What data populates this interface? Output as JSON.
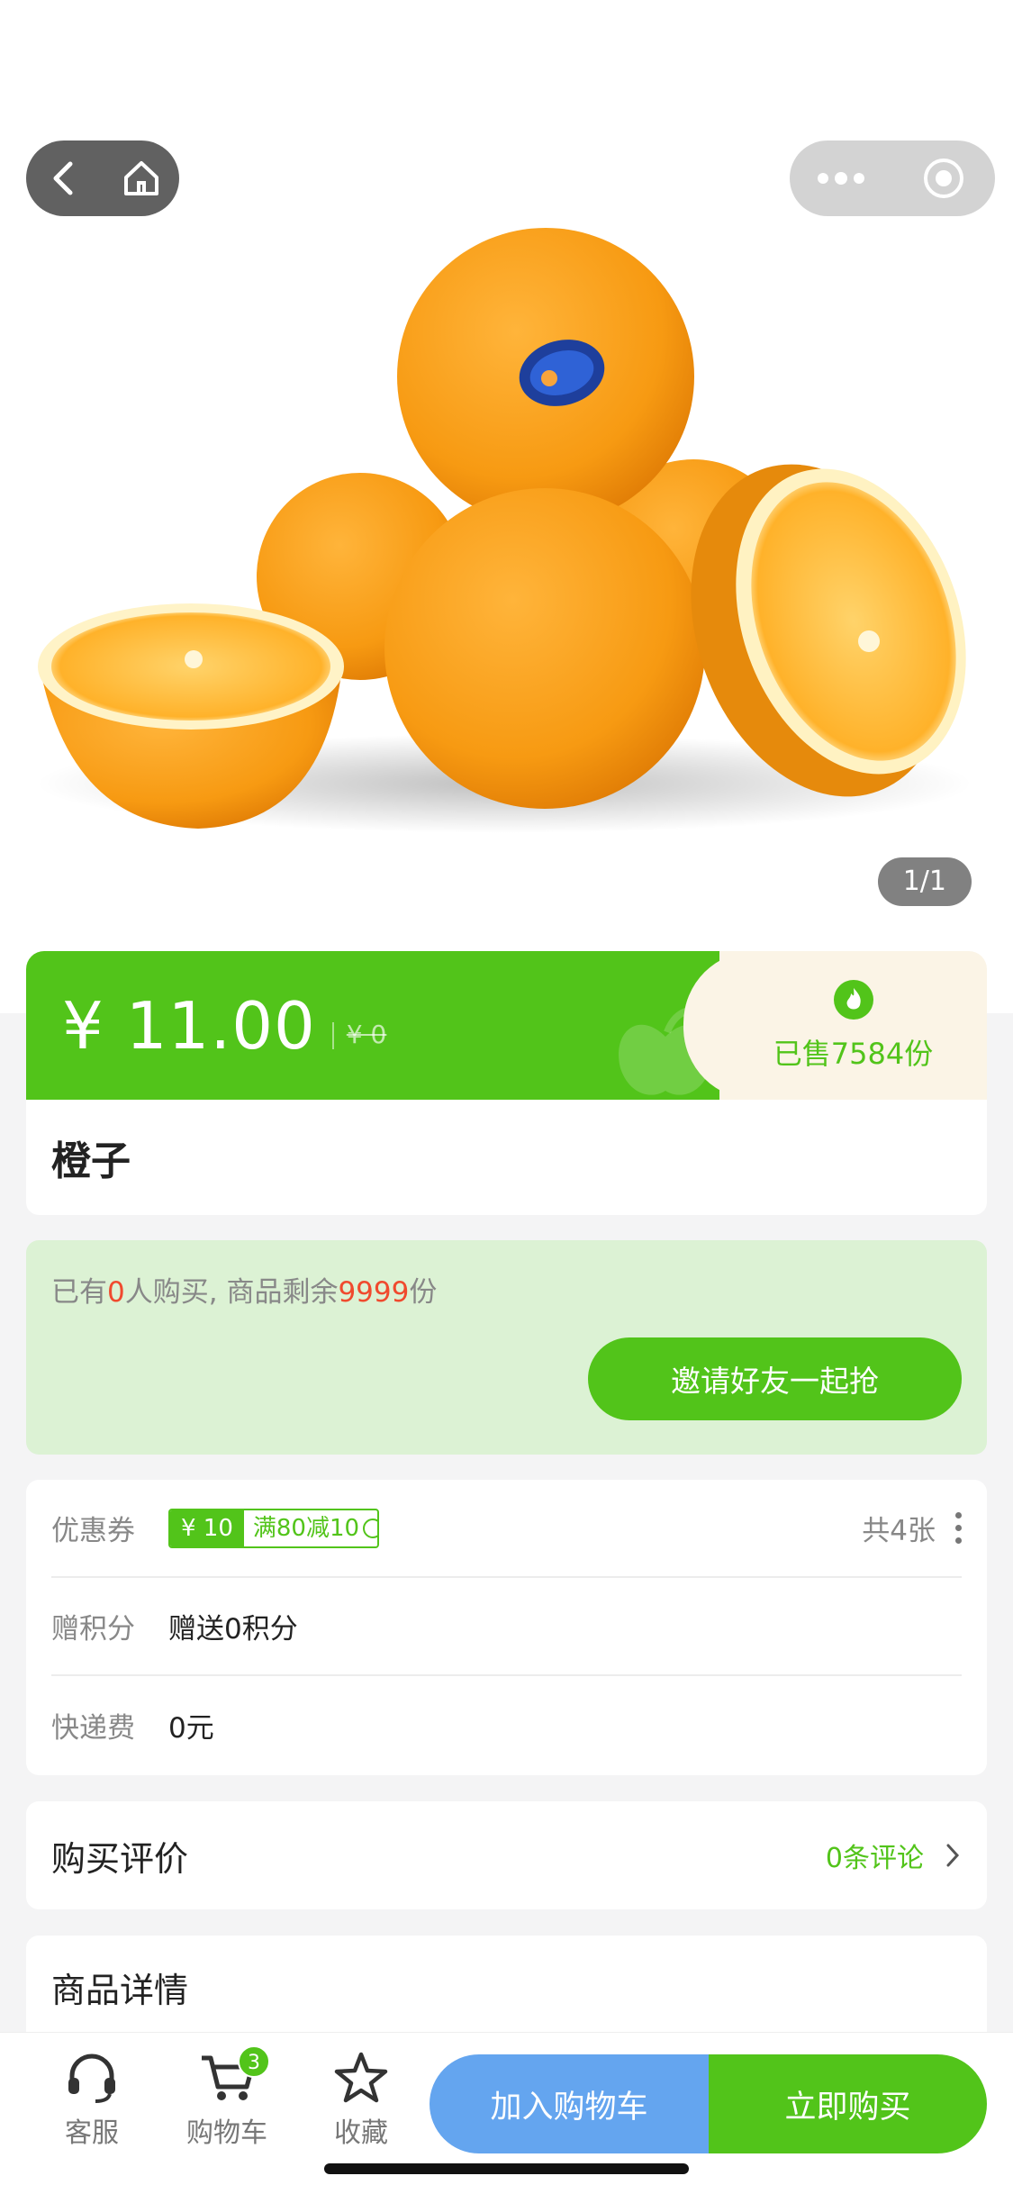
{
  "product": {
    "image_counter": "1/1",
    "price": "¥ 11.00",
    "original_price": "¥ 0",
    "sold": "已售7584份",
    "title": "橙子"
  },
  "group": {
    "prefix": "已有",
    "buyers": "0",
    "middle": "人购买, 商品剩余",
    "stock": "9999",
    "suffix": "份",
    "invite_label": "邀请好友一起抢"
  },
  "info": {
    "coupon_label": "优惠券",
    "coupon_amount": "¥ 10",
    "coupon_desc": "满80减10",
    "coupon_count": "共4张",
    "points_label": "赠积分",
    "points_value": "赠送0积分",
    "shipping_label": "快递费",
    "shipping_value": "0元"
  },
  "reviews": {
    "title": "购买评价",
    "count": "0条评论"
  },
  "details": {
    "title": "商品详情"
  },
  "bottom": {
    "service_label": "客服",
    "cart_label": "购物车",
    "cart_badge": "3",
    "fav_label": "收藏",
    "add_to_cart": "加入购物车",
    "buy_now": "立即购买"
  },
  "colors": {
    "accent_green": "#52c41a",
    "accent_blue": "#64a5ef",
    "highlight_red": "#f04a2e"
  }
}
